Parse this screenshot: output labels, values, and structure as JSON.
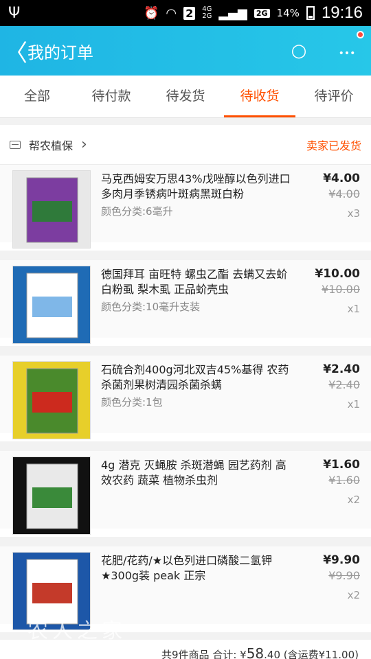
{
  "status_bar": {
    "usb_icon": "usb-icon",
    "sim_label": "2",
    "network_top": "4G",
    "network_bottom": "2G",
    "network_box": "2G",
    "battery": "14%",
    "time": "19:16"
  },
  "nav": {
    "title": "我的订单",
    "back_glyph": "〈",
    "search_glyph": "○",
    "more_glyph": "•••"
  },
  "tabs": [
    {
      "label": "全部"
    },
    {
      "label": "待付款"
    },
    {
      "label": "待发货"
    },
    {
      "label": "待收货"
    },
    {
      "label": "待评价"
    }
  ],
  "shop": {
    "name": "帮农植保",
    "chevron": "›",
    "status": "卖家已发货"
  },
  "items": [
    {
      "name": "马克西姆安万思43%戊唑醇以色列进口多肉月季锈病叶斑病黑斑白粉",
      "spec": "颜色分类:6毫升",
      "price": "¥4.00",
      "original_price": "¥4.00",
      "qty": "x3",
      "thumb_colors": [
        "#e8e8e8",
        "#7c3da0",
        "#2f7a3a"
      ]
    },
    {
      "name": "德国拜耳 亩旺特 螺虫乙酯 去螨又去蚧 白粉虱 梨木虱 正品蚧壳虫",
      "spec": "颜色分类:10毫升支装",
      "price": "¥10.00",
      "original_price": "¥10.00",
      "qty": "x1",
      "thumb_colors": [
        "#1f6bb5",
        "#ffffff",
        "#7fb7e8"
      ]
    },
    {
      "name": "石硫合剂400g河北双吉45%基得 农药杀菌剂果树清园杀菌杀螨",
      "spec": "颜色分类:1包",
      "price": "¥2.40",
      "original_price": "¥2.40",
      "qty": "x1",
      "thumb_colors": [
        "#e7cf2a",
        "#4a8a2c",
        "#cc2a1e"
      ]
    },
    {
      "name": "4g 潜克 灭蝇胺 杀斑潜蝇 园艺药剂 高效农药 蔬菜 植物杀虫剂",
      "spec": "",
      "price": "¥1.60",
      "original_price": "¥1.60",
      "qty": "x2",
      "thumb_colors": [
        "#111111",
        "#e9e9e9",
        "#3a8a3a"
      ]
    },
    {
      "name": "花肥/花药/★以色列进口磷酸二氢钾★300g装 peak 正宗",
      "spec": "",
      "price": "¥9.90",
      "original_price": "¥9.90",
      "qty": "x2",
      "thumb_colors": [
        "#1d57a8",
        "#ffffff",
        "#c43a2a"
      ]
    }
  ],
  "footer": {
    "count_label": "共9件商品",
    "total_label": "合计:",
    "total_symbol": "¥",
    "total_int": "58",
    "total_dec": ".40",
    "shipping": "(含运费¥11.00)"
  },
  "watermark": "农人之家",
  "colors": {
    "accent": "#ff5000",
    "nav_bg": "#1fb5e4"
  }
}
